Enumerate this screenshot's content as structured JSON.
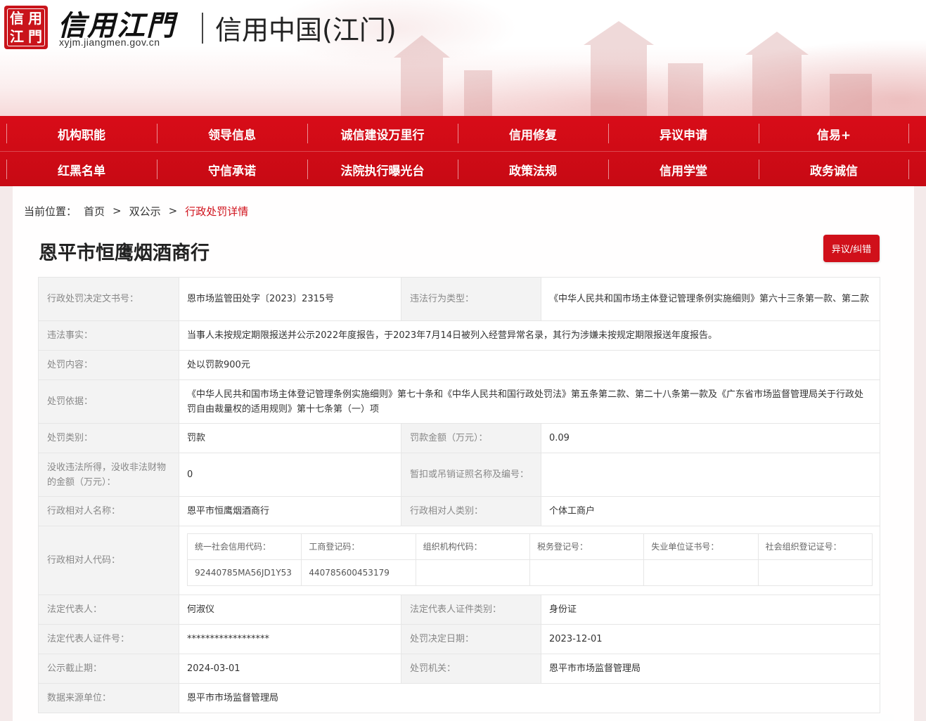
{
  "header": {
    "seal_chars": [
      "信",
      "用",
      "江",
      "門"
    ],
    "logo_text": "信用江門",
    "logo_url": "xyjm.jiangmen.gov.cn",
    "site_title": "信用中国(江门)"
  },
  "nav": {
    "row1": [
      "机构职能",
      "领导信息",
      "诚信建设万里行",
      "信用修复",
      "异议申请",
      "信易+"
    ],
    "row2": [
      "红黑名单",
      "守信承诺",
      "法院执行曝光台",
      "政策法规",
      "信用学堂",
      "政务诚信"
    ]
  },
  "breadcrumb": {
    "label": "当前位置：",
    "home": "首页",
    "section": "双公示",
    "current": "行政处罚详情",
    "sep": ">"
  },
  "title": "恩平市恒鹰烟酒商行",
  "objection_button": "异议/纠错",
  "details": {
    "decision_no_label": "行政处罚决定文书号：",
    "decision_no": "恩市场监管田处字〔2023〕2315号",
    "violation_type_label": "违法行为类型：",
    "violation_type": "《中华人民共和国市场主体登记管理条例实施细则》第六十三条第一款、第二款",
    "facts_label": "违法事实：",
    "facts": "当事人未按规定期限报送并公示2022年度报告，于2023年7月14日被列入经营异常名录，其行为涉嫌未按规定期限报送年度报告。",
    "content_label": "处罚内容：",
    "content": "处以罚款900元",
    "basis_label": "处罚依据：",
    "basis": "《中华人民共和国市场主体登记管理条例实施细则》第七十条和《中华人民共和国行政处罚法》第五条第二款、第二十八条第一款及《广东省市场监督管理局关于行政处罚自由裁量权的适用规则》第十七条第（一）项",
    "category_label": "处罚类别：",
    "category": "罚款",
    "fine_label": "罚款金额（万元）：",
    "fine": "0.09",
    "confiscated_label": "没收违法所得，没收非法财物的金额（万元）：",
    "confiscated": "0",
    "license_label": "暂扣或吊销证照名称及编号：",
    "license": "",
    "party_name_label": "行政相对人名称：",
    "party_name": "恩平市恒鹰烟酒商行",
    "party_type_label": "行政相对人类别：",
    "party_type": "个体工商户",
    "party_code_label": "行政相对人代码：",
    "codes": {
      "headers": [
        "统一社会信用代码：",
        "工商登记码：",
        "组织机构代码：",
        "税务登记号：",
        "失业单位证书号：",
        "社会组织登记证号："
      ],
      "values": [
        "92440785MA56JD1Y53",
        "440785600453179",
        "",
        "",
        "",
        ""
      ]
    },
    "legal_rep_label": "法定代表人：",
    "legal_rep": "何淑仪",
    "legal_rep_id_type_label": "法定代表人证件类别：",
    "legal_rep_id_type": "身份证",
    "legal_rep_id_label": "法定代表人证件号：",
    "legal_rep_id": "******************",
    "decision_date_label": "处罚决定日期：",
    "decision_date": "2023-12-01",
    "publicity_deadline_label": "公示截止期：",
    "publicity_deadline": "2024-03-01",
    "authority_label": "处罚机关：",
    "authority": "恩平市市场监督管理局",
    "source_label": "数据来源单位：",
    "source": "恩平市市场监督管理局"
  }
}
